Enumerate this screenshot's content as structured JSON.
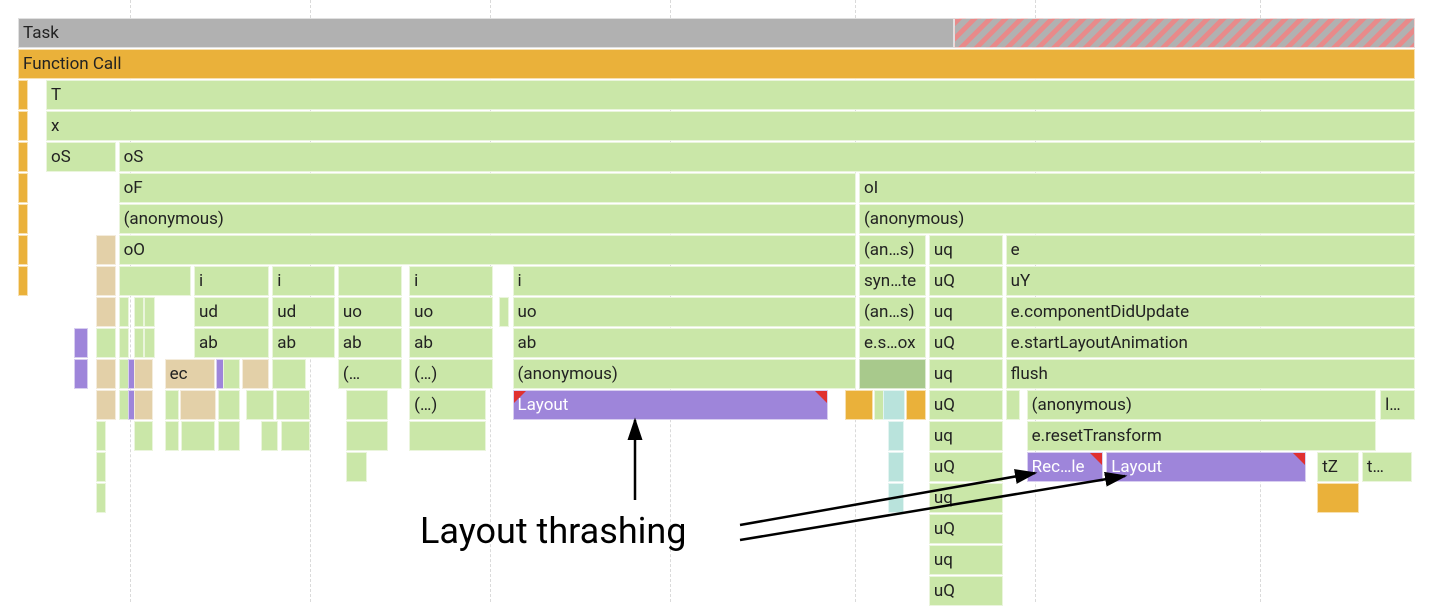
{
  "row0": {
    "task": "Task"
  },
  "row1": {
    "funcCall": "Function Call"
  },
  "row2": {
    "t": "T"
  },
  "row3": {
    "x": "x"
  },
  "row4": {
    "oS1": "oS",
    "oS2": "oS"
  },
  "row5": {
    "oF": "oF",
    "oI": "oI"
  },
  "row6": {
    "anon1": "(anonymous)",
    "anon2": "(anonymous)"
  },
  "row7": {
    "oO": "oO",
    "ans": "(an…s)",
    "uq": "uq",
    "e": "e"
  },
  "row8": {
    "i1": "i",
    "i2": "i",
    "i3": "i",
    "i4": "i",
    "synte": "syn…te",
    "uQ": "uQ",
    "uY": "uY"
  },
  "row9": {
    "ud1": "ud",
    "ud2": "ud",
    "uo1": "uo",
    "uo2": "uo",
    "uo3": "uo",
    "ans": "(an…s)",
    "uq": "uq",
    "cdu": "e.componentDidUpdate"
  },
  "row10": {
    "ab1": "ab",
    "ab2": "ab",
    "ab3": "ab",
    "ab4": "ab",
    "ab5": "ab",
    "esox": "e.s…ox",
    "uQ": "uQ",
    "sla": "e.startLayoutAnimation"
  },
  "row11": {
    "ec": "ec",
    "p1": "(…",
    "p2": "(…)",
    "anon": "(anonymous)",
    "uq": "uq",
    "flush": "flush"
  },
  "row12": {
    "p": "(…)",
    "layout": "Layout",
    "uQ": "uQ",
    "anon": "(anonymous)",
    "l": "l…"
  },
  "row13": {
    "uq": "uq",
    "reset": "e.resetTransform"
  },
  "row14": {
    "uQ": "uQ",
    "rec": "Rec…le",
    "layout": "Layout",
    "tZ": "tZ",
    "t": "t…"
  },
  "row15": {
    "uq": "uq"
  },
  "row16": {
    "uQ": "uQ"
  },
  "row17": {
    "uq": "uq"
  },
  "row18": {
    "uQ": "uQ"
  },
  "annotation": {
    "text": "Layout thrashing"
  }
}
